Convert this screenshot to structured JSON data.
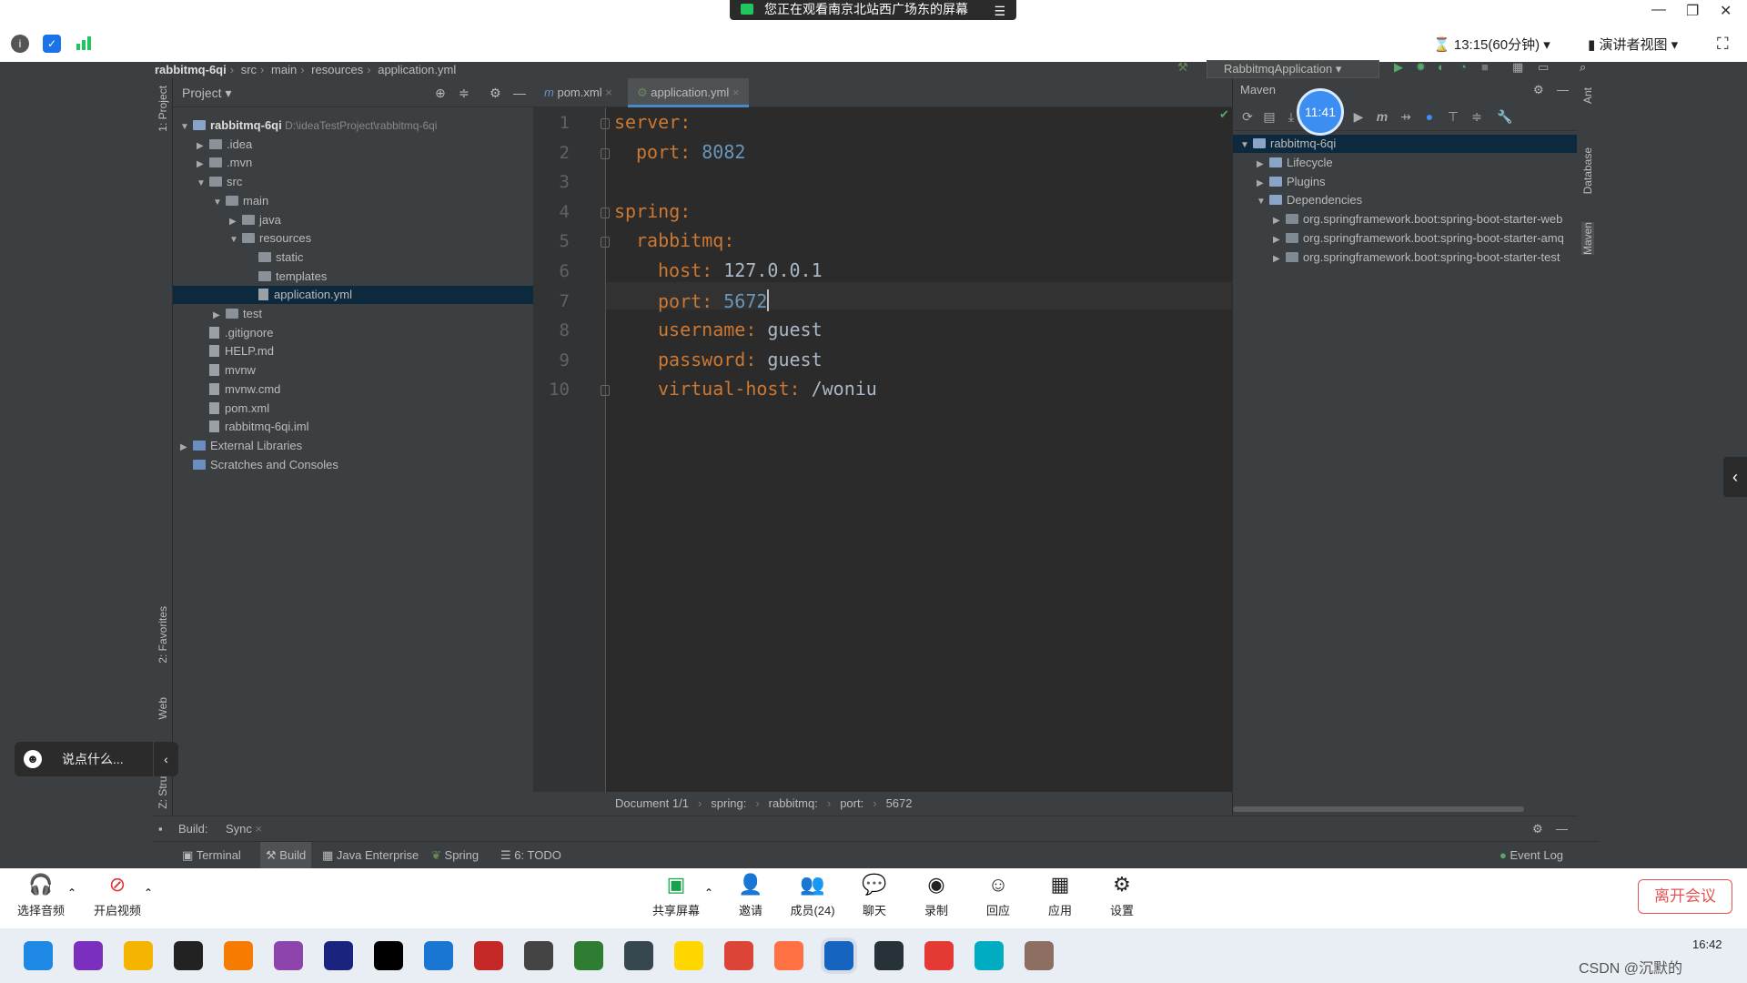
{
  "meeting": {
    "banner": "您正在观看南京北站西广场东的屏幕",
    "banner_menu": "☰",
    "timer": "13:15(60分钟)",
    "presenter_view": "演讲者视图",
    "controls": {
      "audio": "选择音频",
      "video": "开启视频",
      "share": "共享屏幕",
      "invite": "邀请",
      "members": "成员(24)",
      "chat": "聊天",
      "record": "录制",
      "react": "回应",
      "apps": "应用",
      "settings": "设置",
      "leave": "离开会议"
    },
    "chat_placeholder": "说点什么...",
    "clock_bubble": "11:41"
  },
  "ide": {
    "breadcrumb": [
      "rabbitmq-6qi",
      "src",
      "main",
      "resources",
      "application.yml"
    ],
    "run_config": "RabbitmqApplication",
    "left_strip": {
      "project": "1: Project",
      "favorites": "2: Favorites",
      "web": "Web",
      "structure": "Z: Structure"
    },
    "project_panel": {
      "title": "Project",
      "tree": [
        {
          "label": "rabbitmq-6qi",
          "extra": "D:\\ideaTestProject\\rabbitmq-6qi",
          "depth": 0,
          "arrow": "▼",
          "type": "module"
        },
        {
          "label": ".idea",
          "depth": 1,
          "arrow": "▶",
          "type": "folder"
        },
        {
          "label": ".mvn",
          "depth": 1,
          "arrow": "▶",
          "type": "folder"
        },
        {
          "label": "src",
          "depth": 1,
          "arrow": "▼",
          "type": "folder"
        },
        {
          "label": "main",
          "depth": 2,
          "arrow": "▼",
          "type": "folder"
        },
        {
          "label": "java",
          "depth": 3,
          "arrow": "▶",
          "type": "folder"
        },
        {
          "label": "resources",
          "depth": 3,
          "arrow": "▼",
          "type": "folder"
        },
        {
          "label": "static",
          "depth": 4,
          "arrow": "",
          "type": "folder"
        },
        {
          "label": "templates",
          "depth": 4,
          "arrow": "",
          "type": "folder"
        },
        {
          "label": "application.yml",
          "depth": 4,
          "arrow": "",
          "type": "file",
          "selected": true
        },
        {
          "label": "test",
          "depth": 2,
          "arrow": "▶",
          "type": "folder"
        },
        {
          "label": ".gitignore",
          "depth": 1,
          "arrow": "",
          "type": "file"
        },
        {
          "label": "HELP.md",
          "depth": 1,
          "arrow": "",
          "type": "file"
        },
        {
          "label": "mvnw",
          "depth": 1,
          "arrow": "",
          "type": "file"
        },
        {
          "label": "mvnw.cmd",
          "depth": 1,
          "arrow": "",
          "type": "file"
        },
        {
          "label": "pom.xml",
          "depth": 1,
          "arrow": "",
          "type": "file"
        },
        {
          "label": "rabbitmq-6qi.iml",
          "depth": 1,
          "arrow": "",
          "type": "file"
        },
        {
          "label": "External Libraries",
          "depth": 0,
          "arrow": "▶",
          "type": "lib"
        },
        {
          "label": "Scratches and Consoles",
          "depth": 0,
          "arrow": "",
          "type": "lib"
        }
      ]
    },
    "tabs": [
      {
        "label": "pom.xml"
      },
      {
        "label": "application.yml",
        "active": true
      }
    ],
    "code_lines": [
      {
        "n": "1",
        "key": "server:",
        "val": "",
        "indent": 0
      },
      {
        "n": "2",
        "key": "port:",
        "val": "8082",
        "indent": 1,
        "num": true
      },
      {
        "n": "3",
        "key": "",
        "val": "",
        "indent": 0
      },
      {
        "n": "4",
        "key": "spring:",
        "val": "",
        "indent": 0
      },
      {
        "n": "5",
        "key": "rabbitmq:",
        "val": "",
        "indent": 1
      },
      {
        "n": "6",
        "key": "host:",
        "val": "127.0.0.1",
        "indent": 2
      },
      {
        "n": "7",
        "key": "port:",
        "val": "5672",
        "indent": 2,
        "num": true
      },
      {
        "n": "8",
        "key": "username:",
        "val": "guest",
        "indent": 2
      },
      {
        "n": "9",
        "key": "password:",
        "val": "guest",
        "indent": 2
      },
      {
        "n": "10",
        "key": "virtual-host:",
        "val": "/woniu",
        "indent": 2
      }
    ],
    "status_crumbs": [
      "Document 1/1",
      "spring:",
      "rabbitmq:",
      "port:",
      "5672"
    ],
    "maven": {
      "title": "Maven",
      "tree": [
        {
          "label": "rabbitmq-6qi",
          "depth": 0,
          "arrow": "▼",
          "selected": true
        },
        {
          "label": "Lifecycle",
          "depth": 1,
          "arrow": "▶"
        },
        {
          "label": "Plugins",
          "depth": 1,
          "arrow": "▶"
        },
        {
          "label": "Dependencies",
          "depth": 1,
          "arrow": "▼"
        },
        {
          "label": "org.springframework.boot:spring-boot-starter-web",
          "depth": 2,
          "arrow": "▶"
        },
        {
          "label": "org.springframework.boot:spring-boot-starter-amq",
          "depth": 2,
          "arrow": "▶"
        },
        {
          "label": "org.springframework.boot:spring-boot-starter-test",
          "depth": 2,
          "arrow": "▶"
        }
      ]
    },
    "right_strip": {
      "ant": "Ant",
      "database": "Database",
      "maven": "Maven"
    },
    "build_bar": {
      "label": "Build:",
      "tab": "Sync"
    },
    "bottom_tools": {
      "terminal": "Terminal",
      "build": "Build",
      "java_enterprise": "Java Enterprise",
      "spring": "Spring",
      "todo": "6: TODO",
      "event_log": "Event Log"
    }
  },
  "taskbar": {
    "time": "16:42",
    "watermark": "CSDN @沉默的",
    "colors": [
      "#1e88e5",
      "#7b2fbe",
      "#f4b400",
      "#222222",
      "#f57c00",
      "#8e44ad",
      "#1a237e",
      "#000000",
      "#1976d2",
      "#c62828",
      "#444444",
      "#2e7d32",
      "#37474f",
      "#ffd600",
      "#db4437",
      "#ff7043",
      "#1565c0",
      "#263238",
      "#e53935",
      "#00acc1",
      "#8d6e63"
    ]
  }
}
